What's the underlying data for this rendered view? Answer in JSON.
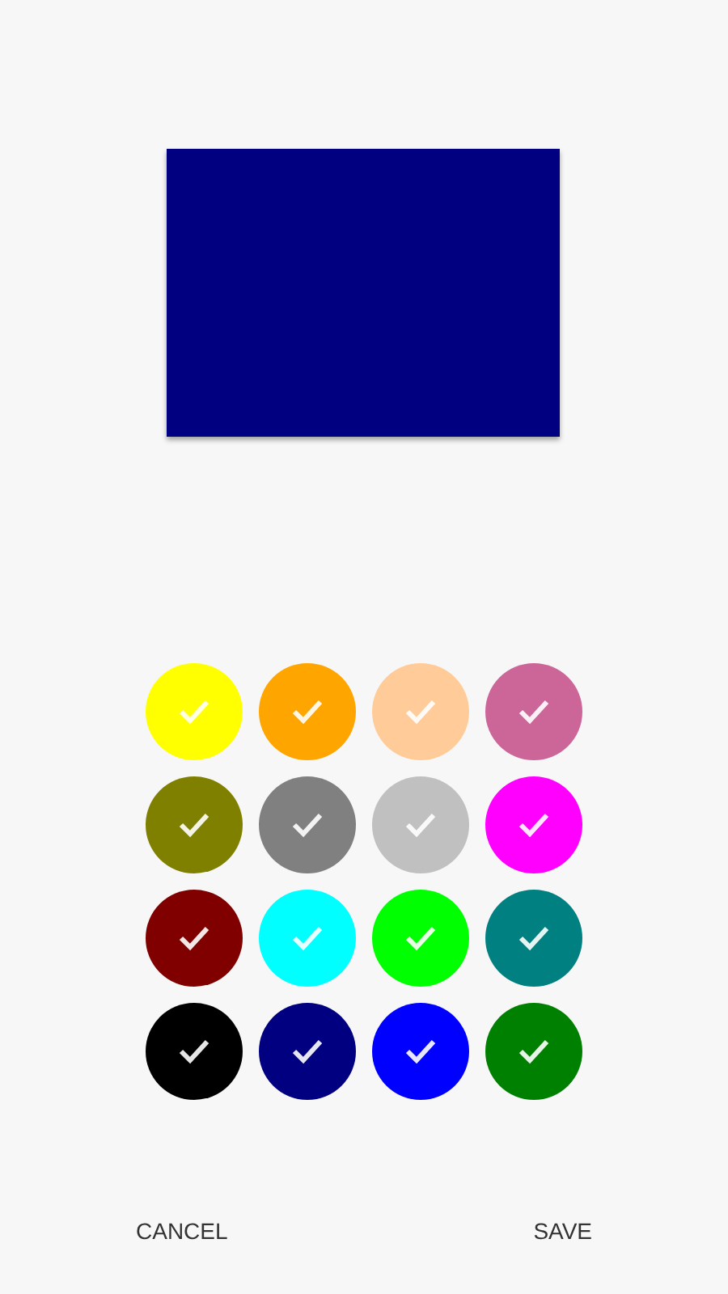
{
  "preview": {
    "color": "#000080"
  },
  "swatches": [
    {
      "color": "#ffff00"
    },
    {
      "color": "#ffa500"
    },
    {
      "color": "#ffcc99"
    },
    {
      "color": "#cc6699"
    },
    {
      "color": "#808000"
    },
    {
      "color": "#808080"
    },
    {
      "color": "#c0c0c0"
    },
    {
      "color": "#ff00ff"
    },
    {
      "color": "#800000"
    },
    {
      "color": "#00ffff"
    },
    {
      "color": "#00ff00"
    },
    {
      "color": "#008080"
    },
    {
      "color": "#000000"
    },
    {
      "color": "#000080"
    },
    {
      "color": "#0000ff"
    },
    {
      "color": "#008000"
    }
  ],
  "buttons": [
    "CANCEL",
    "SAVE"
  ]
}
